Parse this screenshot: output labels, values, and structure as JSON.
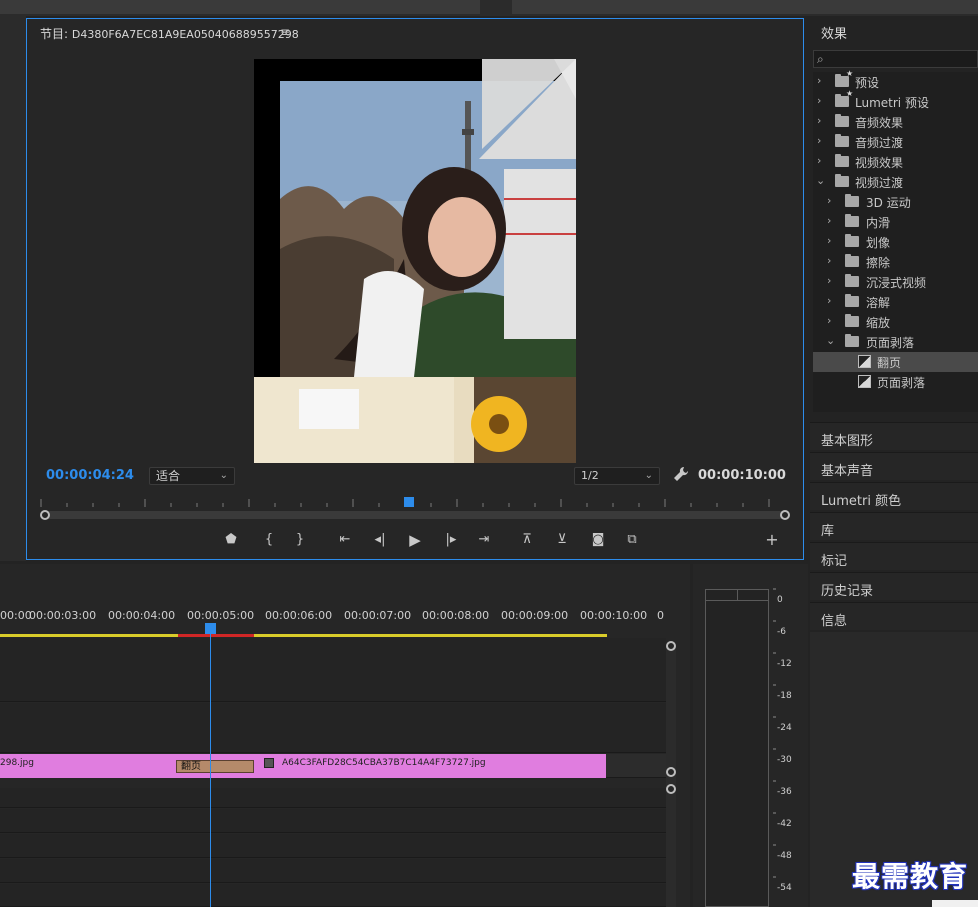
{
  "program_monitor": {
    "title_prefix": "节目:",
    "sequence_id": "D4380F6A7EC81A9EA050406889557298",
    "menu_icon": "≡",
    "current_timecode": "00:00:04:24",
    "fit_label": "适合",
    "resolution_label": "1/2",
    "duration_timecode": "00:00:10:00"
  },
  "transport_icons": [
    "marker-icon",
    "mark-in-icon",
    "mark-out-icon",
    "go-to-in-icon",
    "step-back-icon",
    "play-icon",
    "step-forward-icon",
    "go-to-out-icon",
    "lift-icon",
    "extract-icon",
    "camera-icon",
    "compare-icon",
    "add-icon"
  ],
  "effects": {
    "title": "效果",
    "search_placeholder": "",
    "items": [
      {
        "label": "预设",
        "level": 0,
        "expanded": false,
        "kind": "preset-folder"
      },
      {
        "label": "Lumetri 预设",
        "level": 0,
        "expanded": false,
        "kind": "preset-folder"
      },
      {
        "label": "音频效果",
        "level": 0,
        "expanded": false,
        "kind": "folder"
      },
      {
        "label": "音频过渡",
        "level": 0,
        "expanded": false,
        "kind": "folder"
      },
      {
        "label": "视频效果",
        "level": 0,
        "expanded": false,
        "kind": "folder"
      },
      {
        "label": "视频过渡",
        "level": 0,
        "expanded": true,
        "kind": "folder"
      },
      {
        "label": "3D 运动",
        "level": 1,
        "expanded": false,
        "kind": "folder"
      },
      {
        "label": "内滑",
        "level": 1,
        "expanded": false,
        "kind": "folder"
      },
      {
        "label": "划像",
        "level": 1,
        "expanded": false,
        "kind": "folder"
      },
      {
        "label": "擦除",
        "level": 1,
        "expanded": false,
        "kind": "folder"
      },
      {
        "label": "沉浸式视频",
        "level": 1,
        "expanded": false,
        "kind": "folder"
      },
      {
        "label": "溶解",
        "level": 1,
        "expanded": false,
        "kind": "folder"
      },
      {
        "label": "缩放",
        "level": 1,
        "expanded": false,
        "kind": "folder"
      },
      {
        "label": "页面剥落",
        "level": 1,
        "expanded": true,
        "kind": "folder"
      },
      {
        "label": "翻页",
        "level": 2,
        "kind": "effect",
        "selected": true
      },
      {
        "label": "页面剥落",
        "level": 2,
        "kind": "effect",
        "selected": false
      }
    ]
  },
  "side_panels": [
    "基本图形",
    "基本声音",
    "Lumetri 颜色",
    "库",
    "标记",
    "历史记录",
    "信息"
  ],
  "timeline": {
    "ticks": [
      "00:00",
      "00:00:03:00",
      "00:00:04:00",
      "00:00:05:00",
      "00:00:06:00",
      "00:00:07:00",
      "00:00:08:00",
      "00:00:09:00",
      "00:00:10:00",
      "0"
    ],
    "clip_left_label": "298.jpg",
    "transition_label": "翻页",
    "clip_right_label": "A64C3FAFD28C54CBA37B7C14A4F73727.jpg"
  },
  "audio_meter": {
    "scale": [
      "0",
      "-6",
      "-12",
      "-18",
      "-24",
      "-30",
      "-36",
      "-42",
      "-48",
      "-54"
    ]
  },
  "watermark": "最需教育",
  "colors": {
    "accent": "#2d8ceb",
    "clip": "#e07ddf",
    "transition": "#b58a6a",
    "work_area": "#d9cc2a",
    "render_red": "#d02626"
  }
}
